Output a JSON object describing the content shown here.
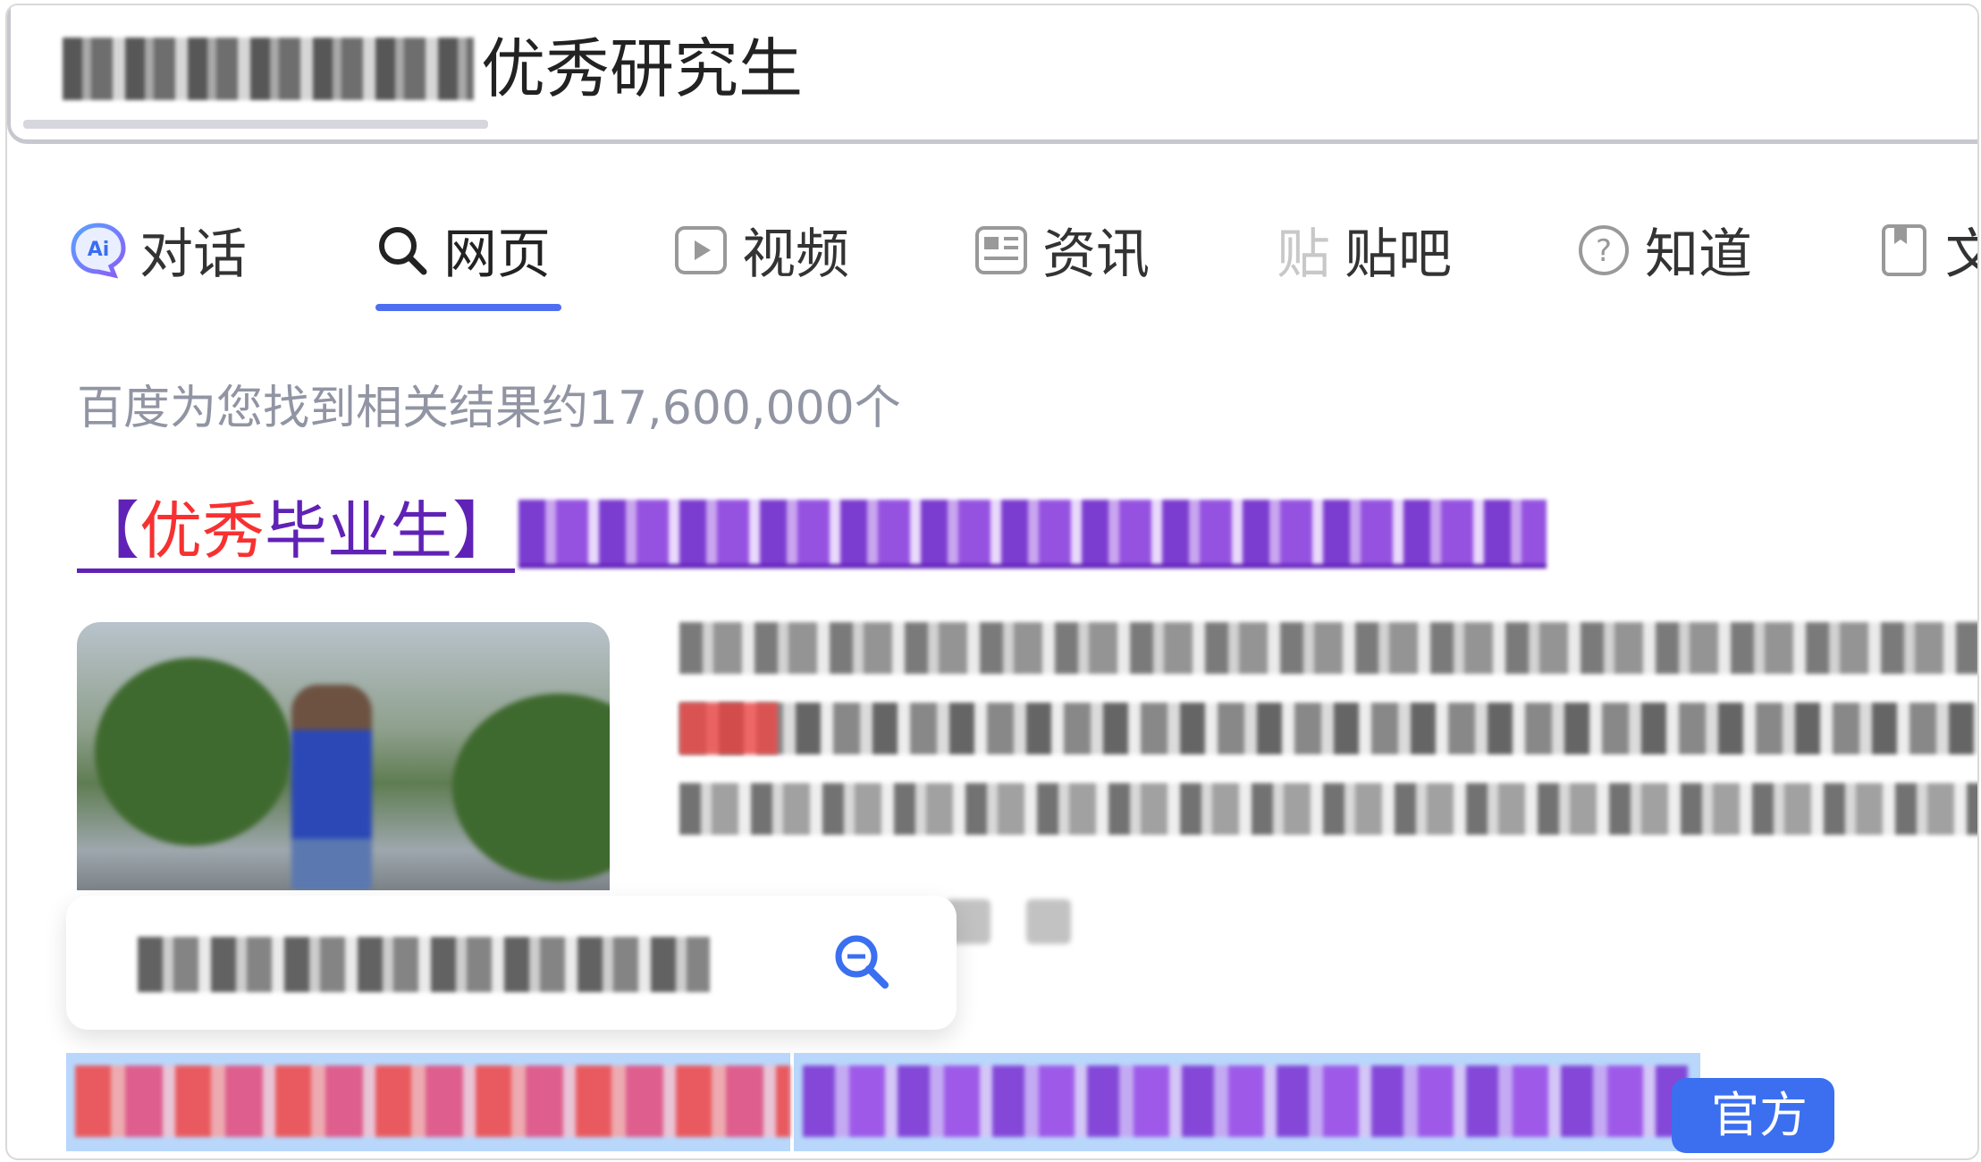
{
  "search": {
    "query_visible": "优秀研究生"
  },
  "tabs": [
    {
      "label": "对话",
      "icon": "ai-chat-icon"
    },
    {
      "label": "网页",
      "icon": "search-icon",
      "active": true
    },
    {
      "label": "视频",
      "icon": "video-icon"
    },
    {
      "label": "资讯",
      "icon": "news-icon"
    },
    {
      "label": "贴吧",
      "icon": "tieba-icon"
    },
    {
      "label": "知道",
      "icon": "question-icon"
    },
    {
      "label": "文",
      "icon": "doc-icon"
    }
  ],
  "results": {
    "count_text": "百度为您找到相关结果约17,600,000个",
    "first": {
      "title_prefix": "【",
      "title_emphasis": "优秀",
      "title_rest": "毕业生】"
    },
    "second": {
      "badge": "官方"
    }
  },
  "colors": {
    "accent": "#4e6ef2",
    "visited_link": "#6022b6",
    "emphasis": "#f73131",
    "badge_bg": "#3b6ff0",
    "muted_text": "#9195a3"
  }
}
